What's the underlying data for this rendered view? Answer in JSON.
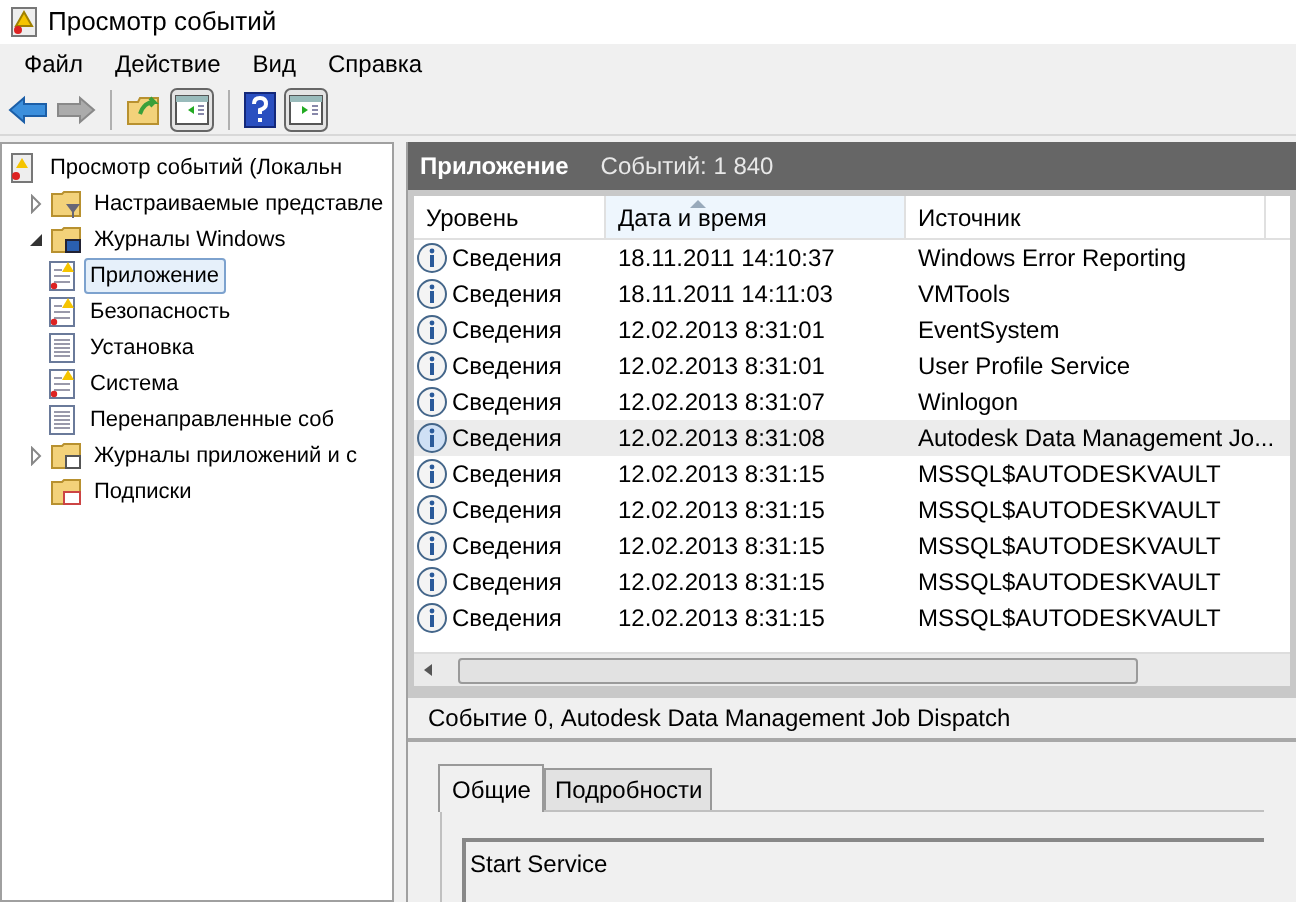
{
  "window": {
    "title": "Просмотр событий"
  },
  "menu": [
    "Файл",
    "Действие",
    "Вид",
    "Справка"
  ],
  "toolbar": [
    {
      "kind": "back",
      "disabled": false
    },
    {
      "kind": "forward",
      "disabled": true
    },
    {
      "kind": "separator"
    },
    {
      "kind": "folder-up",
      "disabled": false
    },
    {
      "kind": "pane-left",
      "disabled": false
    },
    {
      "kind": "separator"
    },
    {
      "kind": "help",
      "disabled": false
    },
    {
      "kind": "pane-right",
      "disabled": false
    }
  ],
  "tree": [
    {
      "label": "Просмотр событий (Локальн",
      "kind": "viewer",
      "selected": false,
      "children": [
        {
          "label": "Настраиваемые представле",
          "kind": "filter-folder",
          "selected": false,
          "expanded": false
        },
        {
          "label": "Журналы Windows",
          "kind": "windows-folder",
          "selected": false,
          "expanded": true,
          "children": [
            {
              "label": "Приложение",
              "kind": "log-warn",
              "selected": true
            },
            {
              "label": "Безопасность",
              "kind": "log-warn",
              "selected": false
            },
            {
              "label": "Установка",
              "kind": "log",
              "selected": false
            },
            {
              "label": "Система",
              "kind": "log-warn",
              "selected": false
            },
            {
              "label": "Перенаправленные соб",
              "kind": "log",
              "selected": false
            }
          ]
        },
        {
          "label": "Журналы приложений и с",
          "kind": "app-folder",
          "selected": false,
          "expanded": false
        },
        {
          "label": "Подписки",
          "kind": "subs-folder",
          "selected": false
        }
      ]
    }
  ],
  "header": {
    "title": "Приложение",
    "count": "Событий: 1 840"
  },
  "table": {
    "columns": [
      {
        "label": "Уровень",
        "sorted": false
      },
      {
        "label": "Дата и время",
        "sorted": true
      },
      {
        "label": "Источник",
        "sorted": false
      }
    ],
    "rows": [
      {
        "level": "Сведения",
        "date": "18.11.2011 14:10:37",
        "source": "Windows Error Reporting",
        "selected": false
      },
      {
        "level": "Сведения",
        "date": "18.11.2011 14:11:03",
        "source": "VMTools",
        "selected": false
      },
      {
        "level": "Сведения",
        "date": "12.02.2013 8:31:01",
        "source": "EventSystem",
        "selected": false
      },
      {
        "level": "Сведения",
        "date": "12.02.2013 8:31:01",
        "source": "User Profile Service",
        "selected": false
      },
      {
        "level": "Сведения",
        "date": "12.02.2013 8:31:07",
        "source": "Winlogon",
        "selected": false
      },
      {
        "level": "Сведения",
        "date": "12.02.2013 8:31:08",
        "source": "Autodesk Data Management Jo...",
        "selected": true
      },
      {
        "level": "Сведения",
        "date": "12.02.2013 8:31:15",
        "source": "MSSQL$AUTODESKVAULT",
        "selected": false
      },
      {
        "level": "Сведения",
        "date": "12.02.2013 8:31:15",
        "source": "MSSQL$AUTODESKVAULT",
        "selected": false
      },
      {
        "level": "Сведения",
        "date": "12.02.2013 8:31:15",
        "source": "MSSQL$AUTODESKVAULT",
        "selected": false
      },
      {
        "level": "Сведения",
        "date": "12.02.2013 8:31:15",
        "source": "MSSQL$AUTODESKVAULT",
        "selected": false
      },
      {
        "level": "Сведения",
        "date": "12.02.2013 8:31:15",
        "source": "MSSQL$AUTODESKVAULT",
        "selected": false
      }
    ]
  },
  "detail": {
    "title": "Событие 0, Autodesk Data Management Job Dispatch",
    "tabs": [
      {
        "label": "Общие",
        "selected": true
      },
      {
        "label": "Подробности",
        "selected": false
      }
    ],
    "text": "Start Service"
  }
}
